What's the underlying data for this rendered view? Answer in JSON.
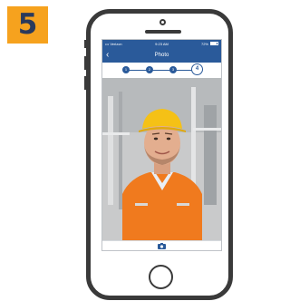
{
  "step_badge": {
    "number": "5",
    "color": "#f6a21e"
  },
  "status_bar": {
    "carrier": "••• Verizon",
    "time": "9:23 AM",
    "battery": "72%"
  },
  "nav": {
    "back_icon": "chevron-left-icon",
    "title": "Photo"
  },
  "stepper": {
    "steps": [
      "1",
      "2",
      "3",
      "4"
    ],
    "active": "4",
    "color": "#2a5a9a"
  },
  "photo": {
    "subject": "worker-in-hard-hat-and-safety-vest"
  },
  "toolbar": {
    "camera_icon": "camera-icon"
  }
}
